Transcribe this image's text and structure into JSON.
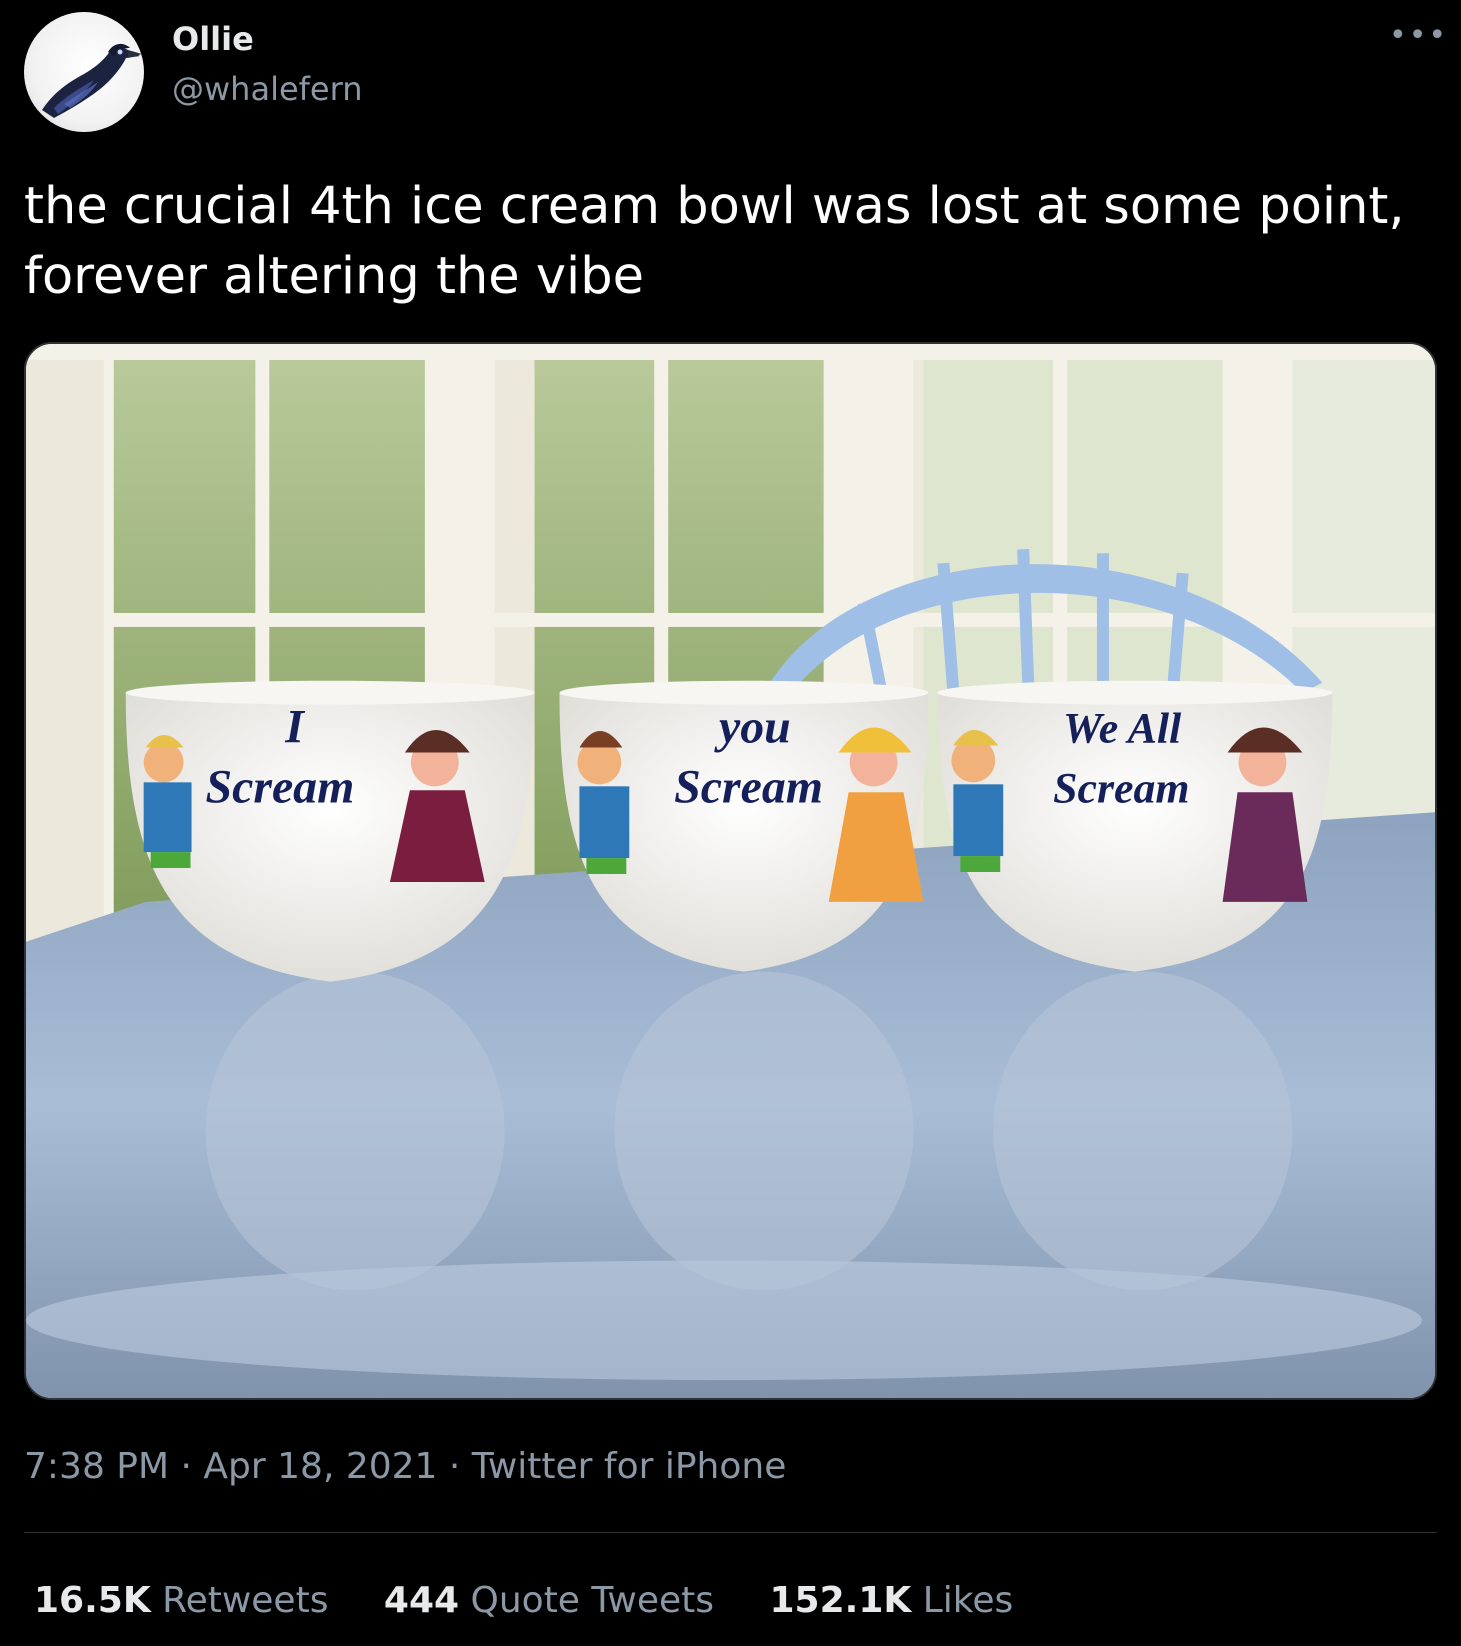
{
  "author": {
    "name": "Ollie",
    "handle": "@whalefern"
  },
  "tweet": {
    "text": "the crucial 4th ice cream bowl was lost at some point, forever altering the vibe"
  },
  "media": {
    "bowls": [
      {
        "top": "I",
        "bottom": "Scream"
      },
      {
        "top": "you",
        "bottom": "Scream"
      },
      {
        "top": "We All",
        "bottom": "Scream"
      }
    ]
  },
  "meta": {
    "time": "7:38 PM",
    "separator": " · ",
    "date": "Apr 18, 2021",
    "source": "Twitter for iPhone"
  },
  "stats": {
    "retweets": {
      "count": "16.5K",
      "label": "Retweets"
    },
    "quotes": {
      "count": "444",
      "label": "Quote Tweets"
    },
    "likes": {
      "count": "152.1K",
      "label": "Likes"
    }
  },
  "icons": {
    "more": "more-options-icon",
    "avatar": "crow-avatar"
  },
  "colors": {
    "background": "#000000",
    "text": "#e7e9ea",
    "secondary": "#8b98a5",
    "divider": "#2f3336"
  }
}
